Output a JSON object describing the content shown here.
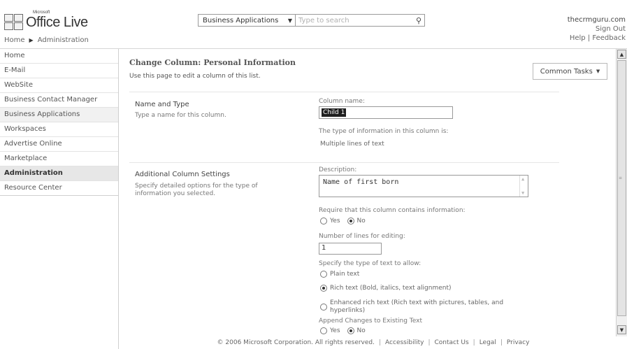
{
  "header": {
    "logo_microsoft": "Microsoft",
    "logo_name": "Office Live",
    "breadcrumb": [
      "Home",
      "Administration"
    ],
    "search_scope": "Business Applications",
    "search_placeholder": "Type to search",
    "user": "thecrmguru.com",
    "sign_out": "Sign Out",
    "help": "Help",
    "feedback": "Feedback"
  },
  "sidebar": {
    "items": [
      {
        "label": "Home"
      },
      {
        "label": "E-Mail"
      },
      {
        "label": "WebSite"
      },
      {
        "label": "Business Contact Manager"
      },
      {
        "label": "Business Applications"
      },
      {
        "label": "Workspaces"
      },
      {
        "label": "Advertise Online"
      },
      {
        "label": "Marketplace"
      },
      {
        "label": "Administration"
      },
      {
        "label": "Resource Center"
      }
    ]
  },
  "main": {
    "title": "Change Column: Personal Information",
    "description": "Use this page to edit a column of this list.",
    "common_tasks": "Common Tasks",
    "name_type": {
      "heading": "Name and Type",
      "desc": "Type a name for this column.",
      "column_name_label": "Column name:",
      "column_name_value": "Child 1",
      "type_label": "The type of information in this column is:",
      "type_value": "Multiple lines of text"
    },
    "additional": {
      "heading": "Additional Column Settings",
      "desc_line1": "Specify detailed options for the type of",
      "desc_line2": "information you selected.",
      "description_label": "Description:",
      "description_value": "Name of first born",
      "require_label": "Require that this column contains information:",
      "yes": "Yes",
      "no": "No",
      "lines_label": "Number of lines for editing:",
      "lines_value": "1",
      "text_type_label": "Specify the type of text to allow:",
      "plain_text": "Plain text",
      "rich_text": "Rich text (Bold, italics, text alignment)",
      "enhanced_line1": "Enhanced rich text (Rich text with pictures, tables, and",
      "enhanced_line2": "hyperlinks)",
      "append_label": "Append Changes to Existing Text",
      "append_yes": "Yes",
      "append_no": "No"
    }
  },
  "footer": {
    "copyright": "© 2006 Microsoft Corporation. All rights reserved.",
    "links": [
      "Accessibility",
      "Contact Us",
      "Legal",
      "Privacy"
    ]
  }
}
